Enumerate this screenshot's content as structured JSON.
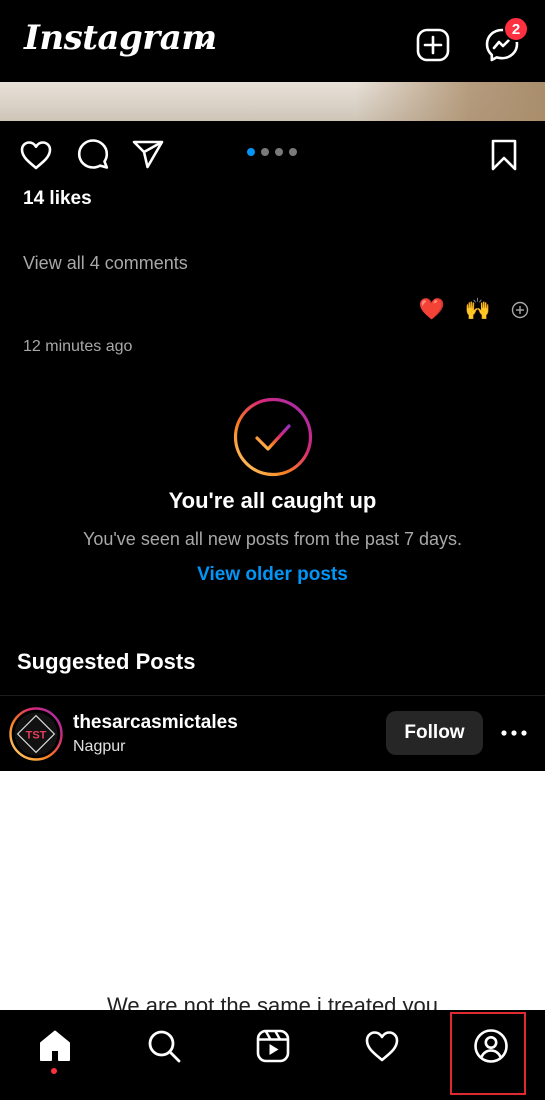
{
  "app": {
    "logo_text": "Instagram",
    "messenger_badge": "2"
  },
  "post": {
    "likes_text": "14 likes",
    "view_comments": "View all 4 comments",
    "reactions": [
      "❤️",
      "🙌"
    ],
    "timestamp": "12 minutes ago",
    "carousel_dots": 4,
    "carousel_active": 0
  },
  "caught_up": {
    "title": "You're all caught up",
    "subtitle": "You've seen all new posts from the past 7 days.",
    "link": "View older posts"
  },
  "suggested": {
    "section_title": "Suggested Posts",
    "username": "thesarcasmictales",
    "location": "Nagpur",
    "follow_label": "Follow",
    "avatar_text": "TST",
    "caption_partial": "We are not the same i treated you"
  },
  "nav": {
    "items": [
      "home-icon",
      "search-icon",
      "reels-icon",
      "heart-icon",
      "profile-icon"
    ],
    "active": "home-icon",
    "highlighted": "profile-icon"
  },
  "colors": {
    "accent_blue": "#0095f6",
    "badge_red": "#ff3040",
    "highlight_red": "#e0282f"
  }
}
